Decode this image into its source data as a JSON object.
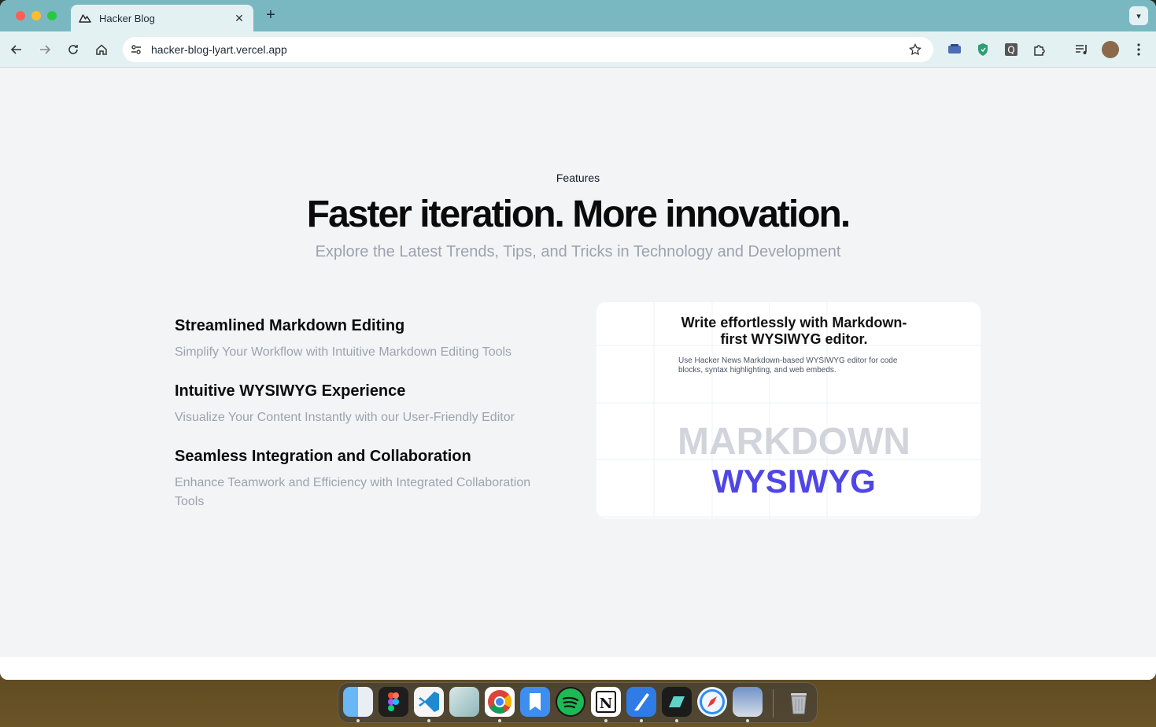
{
  "browser": {
    "tab_title": "Hacker Blog",
    "url": "hacker-blog-lyart.vercel.app"
  },
  "page": {
    "eyebrow": "Features",
    "headline": "Faster iteration. More innovation.",
    "subhead": "Explore the Latest Trends, Tips, and Tricks in Technology and Development",
    "features": [
      {
        "title": "Streamlined Markdown Editing",
        "desc": "Simplify Your Workflow with Intuitive Markdown Editing Tools"
      },
      {
        "title": "Intuitive WYSIWYG Experience",
        "desc": "Visualize Your Content Instantly with our User-Friendly Editor"
      },
      {
        "title": "Seamless Integration and Collaboration",
        "desc": "Enhance Teamwork and Efficiency with Integrated Collaboration Tools"
      }
    ],
    "card": {
      "title": "Write effortlessly with Markdown-first WYSIWYG editor.",
      "desc": "Use Hacker News Markdown-based WYSIWYG editor for code blocks, syntax highlighting, and web embeds.",
      "word_1": "MARKDOWN",
      "word_2": "WYSIWYG"
    }
  },
  "dock": {
    "apps": [
      "finder-icon",
      "figma-icon",
      "vscode-icon",
      "affinity-icon",
      "chrome-icon",
      "books-icon",
      "spotify-icon",
      "notion-icon",
      "testflight-icon",
      "screens-icon",
      "safari-icon",
      "preview-icon",
      "trash-icon"
    ]
  },
  "colors": {
    "accent": "#4f46e5",
    "tabstrip": "#7ab8c1",
    "toolbar": "#e4f1f3",
    "muted": "#9ca3af"
  }
}
